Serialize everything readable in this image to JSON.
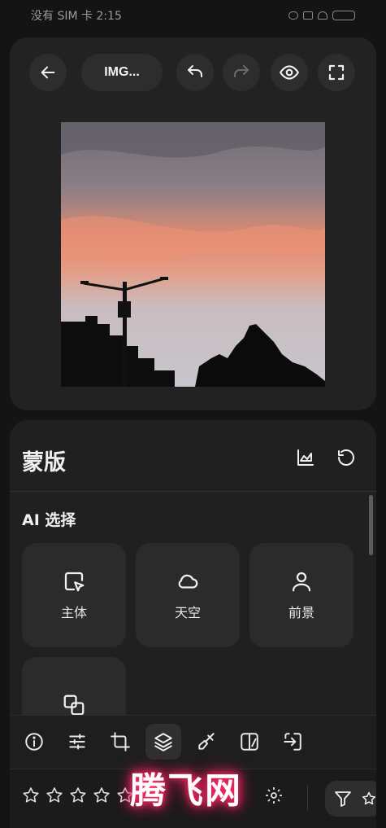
{
  "status_bar": {
    "text": "没有 SIM 卡 2:15"
  },
  "toolbar": {
    "title": "IMG...",
    "icons": [
      "back-arrow-icon",
      "undo-icon",
      "redo-icon",
      "eye-icon",
      "fullscreen-icon"
    ]
  },
  "mask_panel": {
    "title": "蒙版",
    "ai_section_title": "AI 选择",
    "options": [
      {
        "label": "主体",
        "icon": "subject-select-icon"
      },
      {
        "label": "天空",
        "icon": "cloud-icon"
      },
      {
        "label": "前景",
        "icon": "person-icon"
      },
      {
        "label": "",
        "icon": "object-select-icon"
      }
    ]
  },
  "bottom_tabs": {
    "icons": [
      "info-icon",
      "sliders-icon",
      "crop-icon",
      "layers-icon",
      "brush-icon",
      "compare-icon",
      "export-icon"
    ],
    "active": "layers-icon"
  },
  "rating": {
    "stars": 5,
    "selected": 0
  },
  "watermark": {
    "text": "腾飞网"
  },
  "colors": {
    "background": "#141414",
    "card": "#222222",
    "panel": "#202020",
    "accent_glow": "#ff2a6a"
  }
}
